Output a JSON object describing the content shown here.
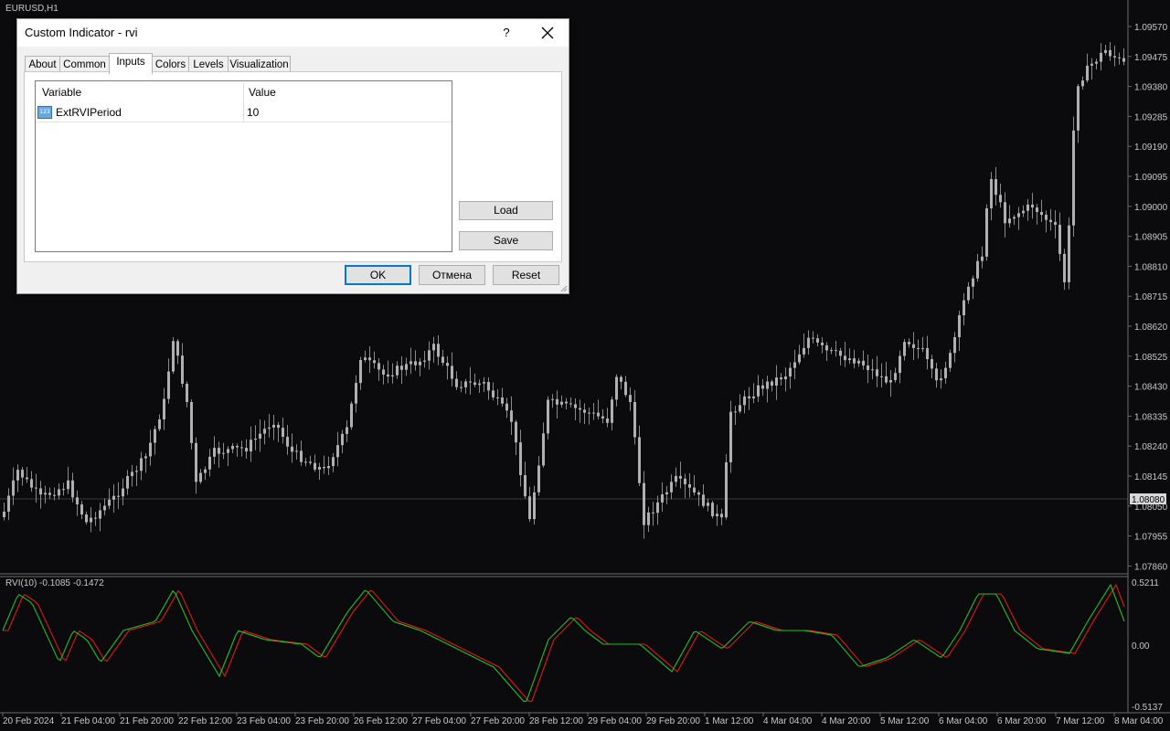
{
  "chart": {
    "symbol": "EURUSD,H1",
    "current_price": "1.08080",
    "price_scale": [
      "1.09570",
      "1.09475",
      "1.09380",
      "1.09285",
      "1.09190",
      "1.09095",
      "1.09000",
      "1.08905",
      "1.08810",
      "1.08715",
      "1.08620",
      "1.08525",
      "1.08430",
      "1.08335",
      "1.08240",
      "1.08145",
      "1.08050",
      "1.07955",
      "1.07860"
    ],
    "indicator": {
      "label": "RVI(10) -0.1085 -0.1472",
      "scale": [
        "0.5211",
        "0.00",
        "-0.5137"
      ]
    },
    "time_axis": [
      "20 Feb 2024",
      "21 Feb 04:00",
      "21 Feb 20:00",
      "22 Feb 12:00",
      "23 Feb 04:00",
      "23 Feb 20:00",
      "26 Feb 12:00",
      "27 Feb 04:00",
      "27 Feb 20:00",
      "28 Feb 12:00",
      "29 Feb 04:00",
      "29 Feb 20:00",
      "1 Mar 12:00",
      "4 Mar 04:00",
      "4 Mar 20:00",
      "5 Mar 12:00",
      "6 Mar 04:00",
      "6 Mar 20:00",
      "7 Mar 12:00",
      "8 Mar 04:00"
    ],
    "colors": {
      "background": "#0b0b0e",
      "candle": "#9a9a9a",
      "rvi_main": "#22c022",
      "rvi_signal": "#e01818"
    }
  },
  "dialog": {
    "title": "Custom Indicator - rvi",
    "help": "?",
    "tabs": [
      "About",
      "Common",
      "Inputs",
      "Colors",
      "Levels",
      "Visualization"
    ],
    "active_tab": "Inputs",
    "table": {
      "headers": [
        "Variable",
        "Value"
      ],
      "rows": [
        {
          "icon": "123",
          "variable": "ExtRVIPeriod",
          "value": "10"
        }
      ]
    },
    "buttons": {
      "load": "Load",
      "save": "Save",
      "ok": "OK",
      "cancel": "Отмена",
      "reset": "Reset"
    }
  }
}
